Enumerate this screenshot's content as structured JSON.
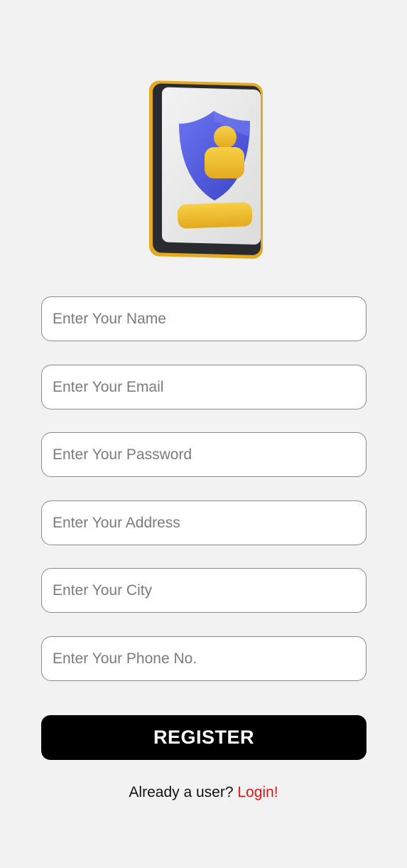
{
  "colors": {
    "background": "#f2f2f2",
    "field_border": "#8a8a8a",
    "button_bg": "#000000",
    "button_text": "#ffffff",
    "link": "#e01818",
    "shield": "#5a63e0",
    "accent_yellow": "#f2bd2c"
  },
  "illustration": {
    "icon": "secure-user-phone-icon"
  },
  "form": {
    "name_placeholder": "Enter Your Name",
    "email_placeholder": "Enter Your Email",
    "password_placeholder": "Enter Your Password",
    "address_placeholder": "Enter Your Address",
    "city_placeholder": "Enter Your City",
    "phone_placeholder": "Enter Your Phone No.",
    "name_value": "",
    "email_value": "",
    "password_value": "",
    "address_value": "",
    "city_value": "",
    "phone_value": ""
  },
  "actions": {
    "register_label": "REGISTER",
    "already_user_text": "Already a user?",
    "login_label": "Login!"
  }
}
